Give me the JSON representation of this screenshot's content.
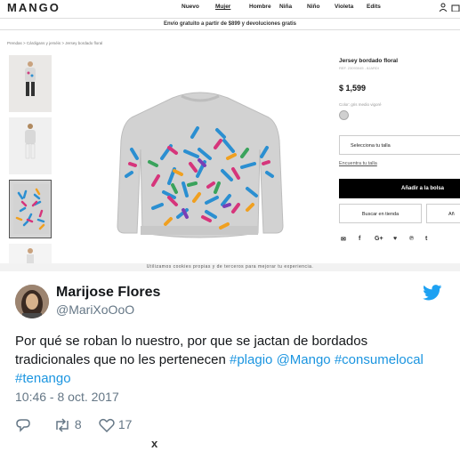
{
  "store": {
    "logo": "MANGO",
    "nav": [
      "Nuevo",
      "Mujer",
      "Hombre",
      "Niña",
      "Niño",
      "Violeta",
      "Edits"
    ],
    "nav_active": "Mujer",
    "shipping_banner": "Envío gratuito a partir de $899 y devoluciones gratis",
    "breadcrumb": "Prendas > Cárdigans y jerséis > Jersey bordado floral",
    "product": {
      "name": "Jersey bordado floral",
      "ref": "REF. 23093045 - 8JARDI",
      "price": "$ 1,599",
      "color_label": "Color: gris medio vigoré",
      "size_label": "Selecciona tu talla",
      "size_guide": "Encuentra tu talla",
      "add_to_bag": "Añadir a la bolsa",
      "find_store": "Buscar en tienda",
      "favorites_partial": "Añ"
    },
    "share_icons": [
      "✉",
      "f",
      "G+",
      "♥",
      "℗",
      "t"
    ],
    "cookie_notice": "Utilizamos cookies propias y de terceros para mejorar tu experiencia."
  },
  "tweet": {
    "name": "Marijose Flores",
    "handle": "@MariXoOoO",
    "text_plain": "Por qué se roban lo nuestro, por que se jactan de bordados tradicionales que no les pertenecen ",
    "tag1": "#plagio",
    "tag2": "@Mango",
    "tag3": "#consumelocal",
    "tag4": "#tenango",
    "timestamp": "10:46 - 8 oct. 2017",
    "retweets": "8",
    "likes": "17",
    "close": "x"
  },
  "colors": {
    "link": "#1b95e0",
    "twitter_blue": "#1da1f2",
    "muted": "#657786"
  }
}
